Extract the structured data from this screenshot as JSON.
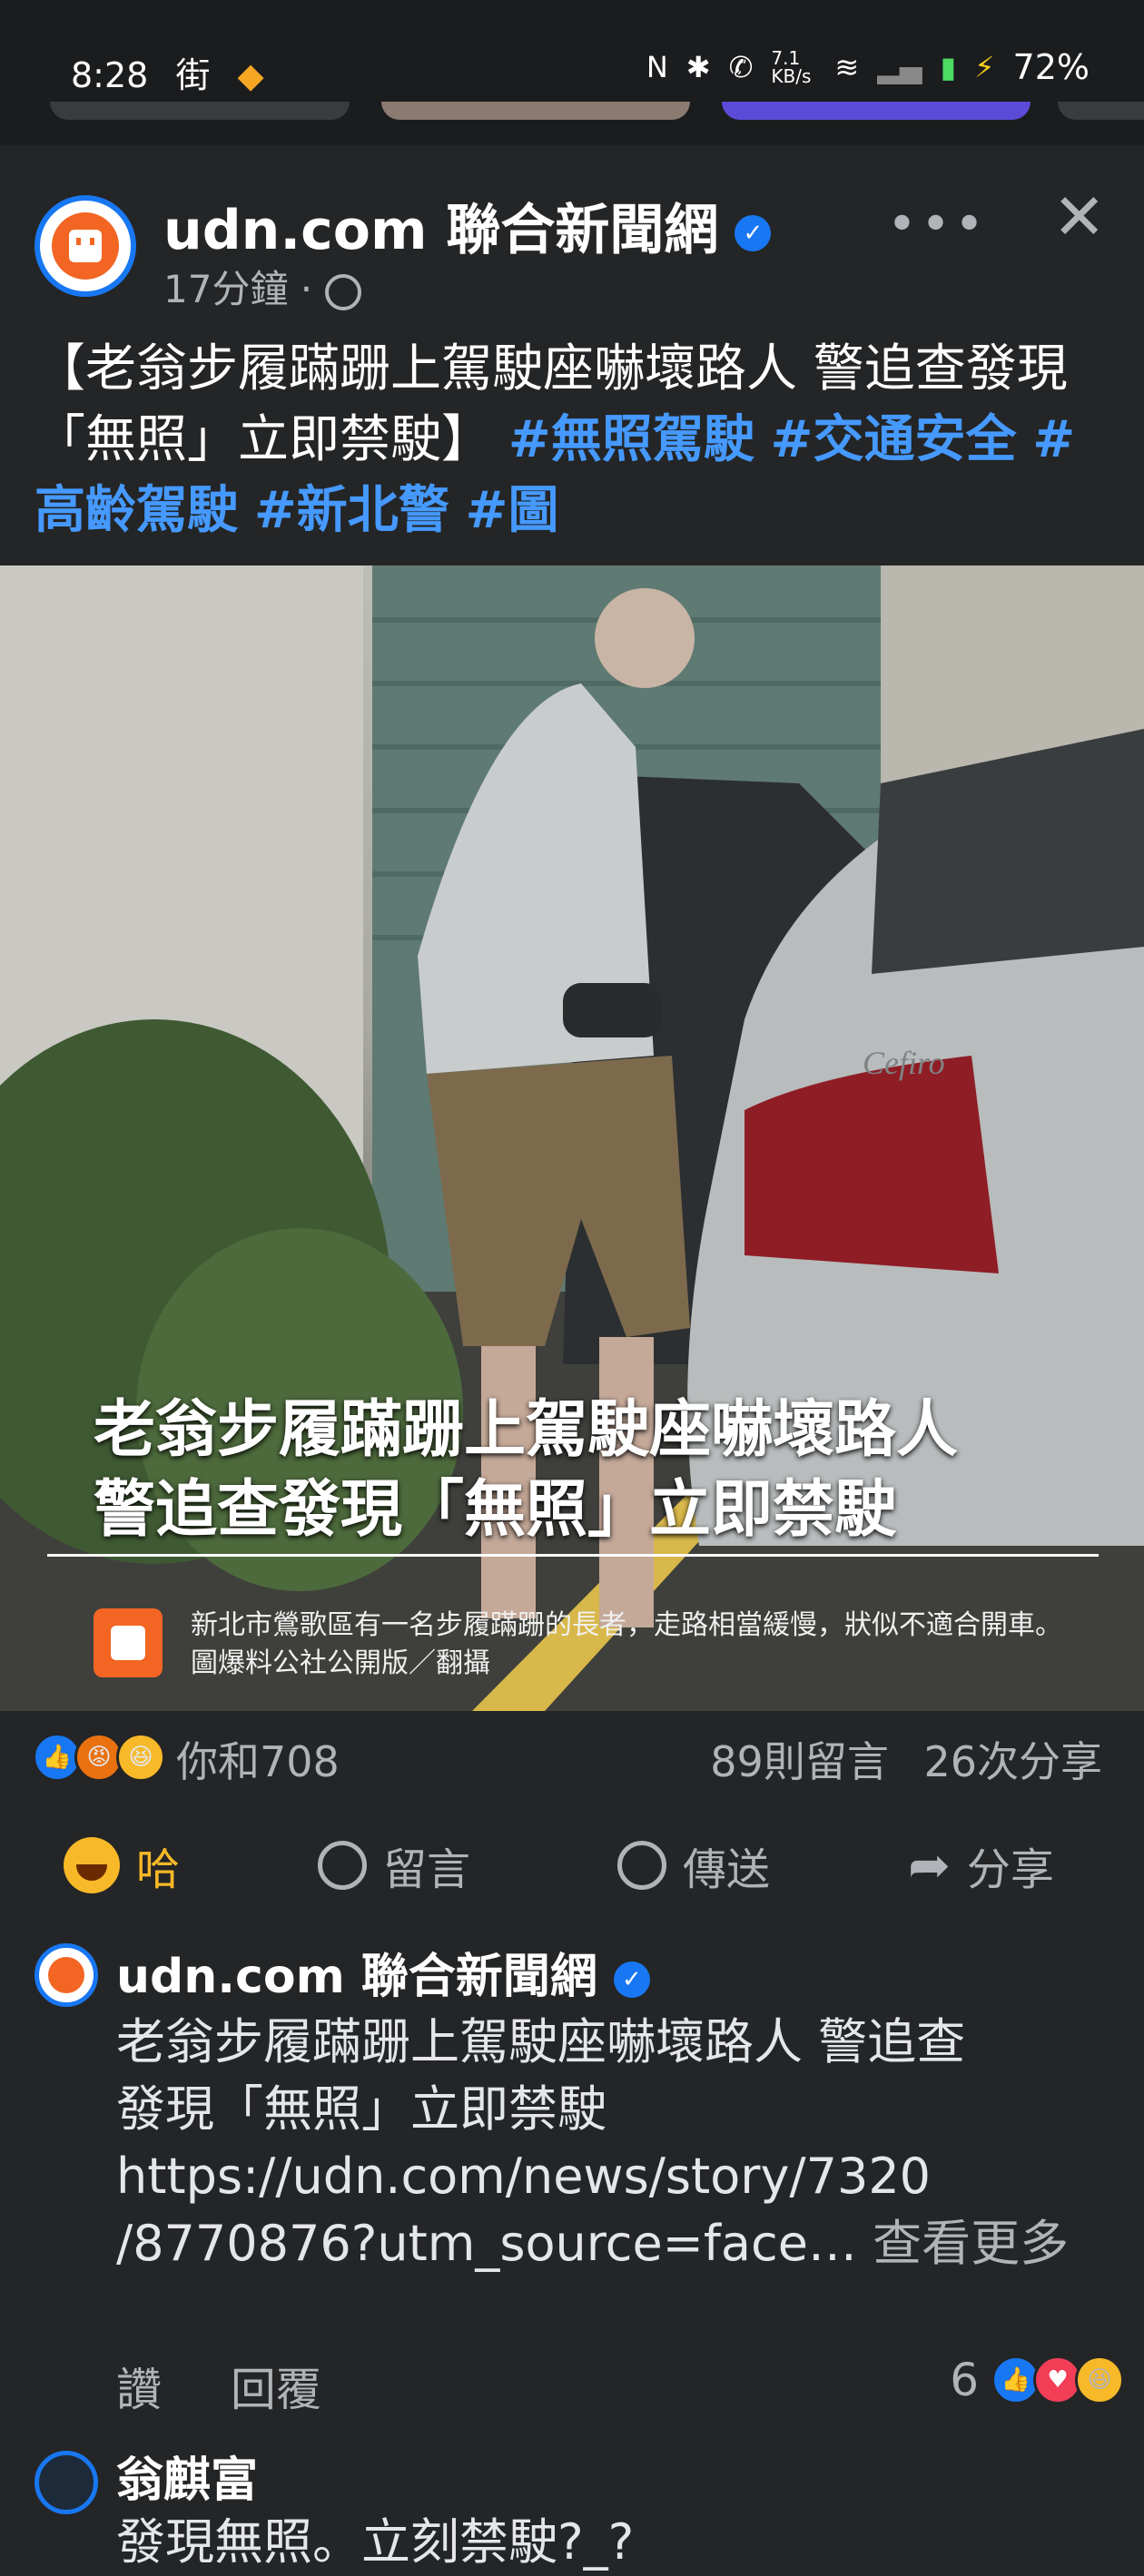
{
  "status": {
    "time": "8:28",
    "carrier": "街",
    "net_speed": "7.1 KB/s",
    "battery": "72%"
  },
  "post": {
    "page_name": "udn.com 聯合新聞網",
    "time": "17分鐘 ·",
    "text_main": "【老翁步履蹣跚上駕駛座嚇壞路人 警追查發現「無照」立即禁駛】",
    "hashtags": [
      "#無照駕駛",
      "#交通安全",
      "#高齡駕駛",
      "#新北警",
      "#圖"
    ],
    "photo_caption_line1": "老翁步履蹣跚上駕駛座嚇壞路人",
    "photo_caption_line2": "警追查發現「無照」立即禁駛",
    "photo_credit": "新北市鶯歌區有一名步履蹣跚的長者，走路相當緩慢，狀似不適合開車。圖爆料公社公開版／翻攝",
    "car_badge": "Cefiro",
    "reaction_summary": "你和708",
    "comments_count": "89則留言",
    "shares_count": "26次分享"
  },
  "actions": {
    "haha": "哈",
    "comment": "留言",
    "send": "傳送",
    "share": "分享"
  },
  "comments": [
    {
      "name": "udn.com 聯合新聞網",
      "line1": "老翁步履蹣跚上駕駛座嚇壞路人 警追查",
      "line2": "發現「無照」立即禁駛",
      "line3": "https://udn.com/news/story/7320",
      "line4": "/8770876?utm_source=face…",
      "see_more": "查看更多",
      "like": "讚",
      "reply": "回覆",
      "reaction_count": "6"
    },
    {
      "name": "翁麒富",
      "text": "發現無照。立刻禁駛?_?"
    }
  ],
  "colors": {
    "background": "#242526",
    "link_blue": "#4599ff",
    "haha_yellow": "#f7b928",
    "brand_orange": "#f26522"
  }
}
